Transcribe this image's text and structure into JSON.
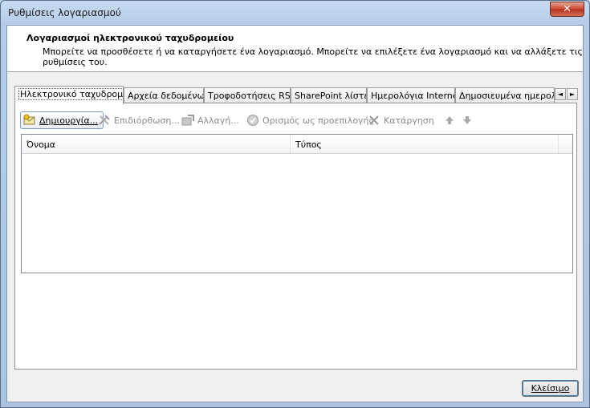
{
  "window": {
    "title": "Ρυθμίσεις λογαριασμού",
    "close_glyph": "✕"
  },
  "header": {
    "title": "Λογαριασμοί ηλεκτρονικού ταχυδρομείου",
    "description": "Μπορείτε να προσθέσετε ή να καταργήσετε ένα λογαριασμό. Μπορείτε να επιλέξετε ένα λογαριασμό και να αλλάξετε τις ρυθμίσεις του."
  },
  "tabs": [
    {
      "label": "Ηλεκτρονικό ταχυδρομείο",
      "active": true
    },
    {
      "label": "Αρχεία δεδομένων"
    },
    {
      "label": "Τροφοδοτήσεις RSS"
    },
    {
      "label": "SharePoint λίστες"
    },
    {
      "label": "Ημερολόγια Internet"
    },
    {
      "label": "Δημοσιευμένα ημερολόγ"
    }
  ],
  "tab_scroll": {
    "left": "◄",
    "right": "►"
  },
  "toolbar": {
    "new_label": "Δημιουργία...",
    "repair_label": "Επιδιόρθωση...",
    "change_label": "Αλλαγή...",
    "default_label": "Ορισμός ως προεπιλογής",
    "remove_label": "Κατάργηση"
  },
  "list": {
    "columns": [
      "Όνομα",
      "Τύπος"
    ],
    "rows": []
  },
  "footer": {
    "close_label": "Κλείσιμο"
  },
  "colors": {
    "title_gradient_top": "#c7dbf0",
    "close_red": "#c9452b",
    "disabled_text": "#8a8a8a"
  },
  "icons": {
    "new": "envelope-new-icon",
    "repair": "tools-icon",
    "change": "change-icon",
    "default": "checkmark-circle-icon",
    "remove": "x-icon",
    "up": "arrow-up-icon",
    "down": "arrow-down-icon"
  }
}
